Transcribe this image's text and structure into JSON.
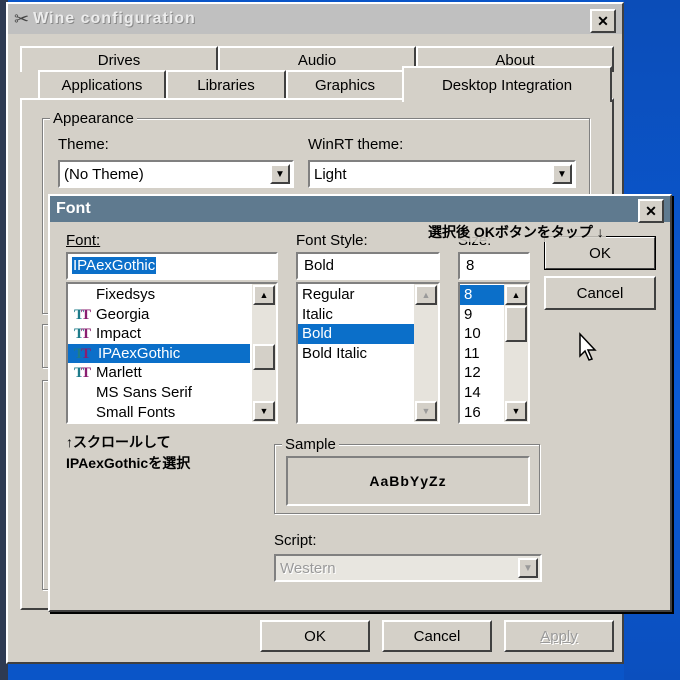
{
  "wine": {
    "title": "Wine configuration",
    "tabs_row1": [
      "Drives",
      "Audio",
      "About"
    ],
    "tabs_row2": [
      "Applications",
      "Libraries",
      "Graphics",
      "Desktop Integration"
    ],
    "appearance": {
      "group_label": "Appearance",
      "theme_label": "Theme:",
      "theme_value": "(No Theme)",
      "winrt_label": "WinRT theme:",
      "winrt_value": "Light"
    },
    "buttons": {
      "ok": "OK",
      "cancel": "Cancel",
      "apply": "Apply"
    }
  },
  "font_dialog": {
    "title": "Font",
    "font_label": "Font:",
    "font_value": "IPAexGothic",
    "fonts": [
      {
        "name": "Fixedsys",
        "tt": false
      },
      {
        "name": "Georgia",
        "tt": true
      },
      {
        "name": "Impact",
        "tt": true
      },
      {
        "name": "IPAexGothic",
        "tt": true,
        "selected": true
      },
      {
        "name": "Marlett",
        "tt": true
      },
      {
        "name": "MS Sans Serif",
        "tt": false
      },
      {
        "name": "Small Fonts",
        "tt": false
      }
    ],
    "style_label": "Font Style:",
    "style_value": "Bold",
    "styles": [
      {
        "name": "Regular"
      },
      {
        "name": "Italic"
      },
      {
        "name": "Bold",
        "selected": true
      },
      {
        "name": "Bold Italic"
      }
    ],
    "size_label": "Size:",
    "size_value": "8",
    "sizes": [
      {
        "name": "8",
        "selected": true
      },
      {
        "name": "9"
      },
      {
        "name": "10"
      },
      {
        "name": "11"
      },
      {
        "name": "12"
      },
      {
        "name": "14"
      },
      {
        "name": "16"
      }
    ],
    "ok_label": "OK",
    "cancel_label": "Cancel",
    "sample_label": "Sample",
    "sample_text": "AaBbYyZz",
    "script_label": "Script:",
    "script_value": "Western"
  },
  "annotations": {
    "tap_ok": "選択後 OKボタンをタップ ↓",
    "scroll_line1": "↑スクロールして",
    "scroll_line2": "IPAexGothicを選択"
  },
  "colors": {
    "selection": "#0b6fc9",
    "title_active": "#5f7a8f",
    "title_inactive": "#c0c0c0",
    "desktop": "#0a55c8"
  }
}
